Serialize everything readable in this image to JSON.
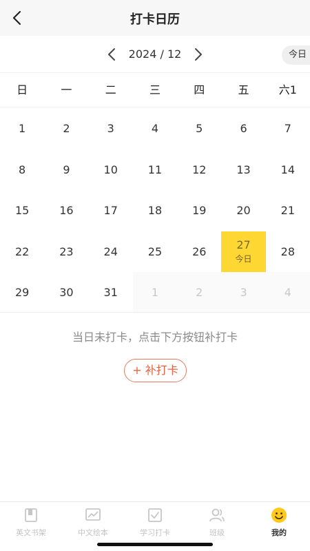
{
  "header": {
    "title": "打卡日历"
  },
  "month_nav": {
    "label": "2024 / 12",
    "today_label": "今日"
  },
  "weekdays": [
    "日",
    "一",
    "二",
    "三",
    "四",
    "五",
    "六1"
  ],
  "calendar": {
    "rows": [
      [
        {
          "d": "1"
        },
        {
          "d": "2"
        },
        {
          "d": "3"
        },
        {
          "d": "4"
        },
        {
          "d": "5"
        },
        {
          "d": "6"
        },
        {
          "d": "7"
        }
      ],
      [
        {
          "d": "8"
        },
        {
          "d": "9"
        },
        {
          "d": "10"
        },
        {
          "d": "11"
        },
        {
          "d": "12"
        },
        {
          "d": "13"
        },
        {
          "d": "14"
        }
      ],
      [
        {
          "d": "15"
        },
        {
          "d": "16"
        },
        {
          "d": "17"
        },
        {
          "d": "18"
        },
        {
          "d": "19"
        },
        {
          "d": "20"
        },
        {
          "d": "21"
        }
      ],
      [
        {
          "d": "22"
        },
        {
          "d": "23"
        },
        {
          "d": "24"
        },
        {
          "d": "25"
        },
        {
          "d": "26"
        },
        {
          "d": "27",
          "today": true,
          "sub": "今日"
        },
        {
          "d": "28"
        }
      ],
      [
        {
          "d": "29"
        },
        {
          "d": "30"
        },
        {
          "d": "31"
        },
        {
          "d": "1",
          "other": true
        },
        {
          "d": "2",
          "other": true
        },
        {
          "d": "3",
          "other": true
        },
        {
          "d": "4",
          "other": true
        }
      ]
    ]
  },
  "status": {
    "message": "当日未打卡，点击下方按钮补打卡",
    "makeup_button": "+ 补打卡"
  },
  "tabbar": {
    "items": [
      {
        "label": "英文书架",
        "icon": "book-icon",
        "active": false
      },
      {
        "label": "中文绘本",
        "icon": "chart-icon",
        "active": false
      },
      {
        "label": "学习打卡",
        "icon": "checkin-icon",
        "active": false
      },
      {
        "label": "班级",
        "icon": "people-icon",
        "active": false
      },
      {
        "label": "我的",
        "icon": "smile-icon",
        "active": true
      }
    ]
  },
  "colors": {
    "today_highlight": "#ffd733",
    "accent_button": "#e3613e",
    "active_tab_icon": "#ffc81a"
  }
}
